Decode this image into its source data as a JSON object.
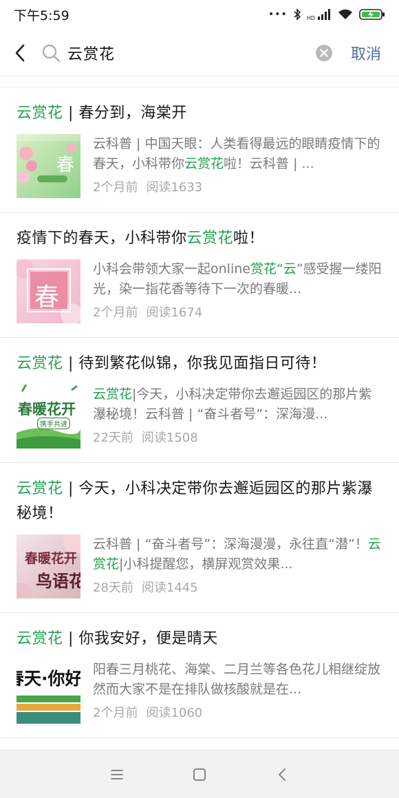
{
  "status_bar": {
    "time": "下午5:59",
    "dots": "•••",
    "network_label": "HD"
  },
  "search": {
    "query": "云赏花",
    "cancel_label": "取消"
  },
  "results": [
    {
      "title_hl": "云赏花",
      "title_rest": " | 春分到，海棠开",
      "snippet_before": "云科普 | 中国天眼：人类看得最远的眼睛疫情下的春天，小科带你",
      "snippet_hl": "云赏花",
      "snippet_after": "啦！云科普 | ...",
      "time": "2个月前",
      "reads": "阅读1633",
      "thumb_text": "春"
    },
    {
      "title_before": "疫情下的春天，小科带你",
      "title_hl": "云赏花",
      "title_after": "啦！",
      "snippet_before": "小科会带领大家一起online",
      "snippet_hl": "赏花“云",
      "snippet_after": "”感受握一缕阳光，染一指花香等待下一次的春暖...",
      "time": "2个月前",
      "reads": "阅读1674",
      "thumb_text": "春"
    },
    {
      "title_hl": "云赏花",
      "title_rest": " | 待到繁花似锦，你我见面指日可待！",
      "snippet_hl": "云赏花",
      "snippet_after": "|今天，小科决定带你去邂逅园区的那片紫瀑秘境！云科普 | “奋斗者号”：深海漫...",
      "time": "22天前",
      "reads": "阅读1508",
      "thumb_text": "春暖花开",
      "thumb_sub": "携手共进"
    },
    {
      "title_hl": "云赏花",
      "title_rest": " | 今天，小科决定带你去邂逅园区的那片紫瀑秘境！",
      "snippet_before": "云科普 | “奋斗者号”：深海漫漫，永往直“潜”！",
      "snippet_hl": "云赏花",
      "snippet_after": "|小科提醒您，横屏观赏效果...",
      "time": "28天前",
      "reads": "阅读1445",
      "thumb_text": "春暖花开",
      "thumb_sub": "鸟语花"
    },
    {
      "title_hl": "云赏花",
      "title_rest": " | 你我安好，便是晴天",
      "snippet_before": "阳春三月桃花、海棠、二月兰等各色花儿相继绽放然而大家不是在排队做核酸就是在...",
      "time": "2个月前",
      "reads": "阅读1060",
      "thumb_text": "春天·你好"
    }
  ],
  "colors": {
    "highlight": "#23a050",
    "cancel": "#4a6f9c",
    "meta": "#a8a8a8"
  },
  "icons": [
    "back-arrow-icon",
    "search-icon",
    "clear-icon",
    "menu-icon",
    "home-icon",
    "back-icon"
  ]
}
